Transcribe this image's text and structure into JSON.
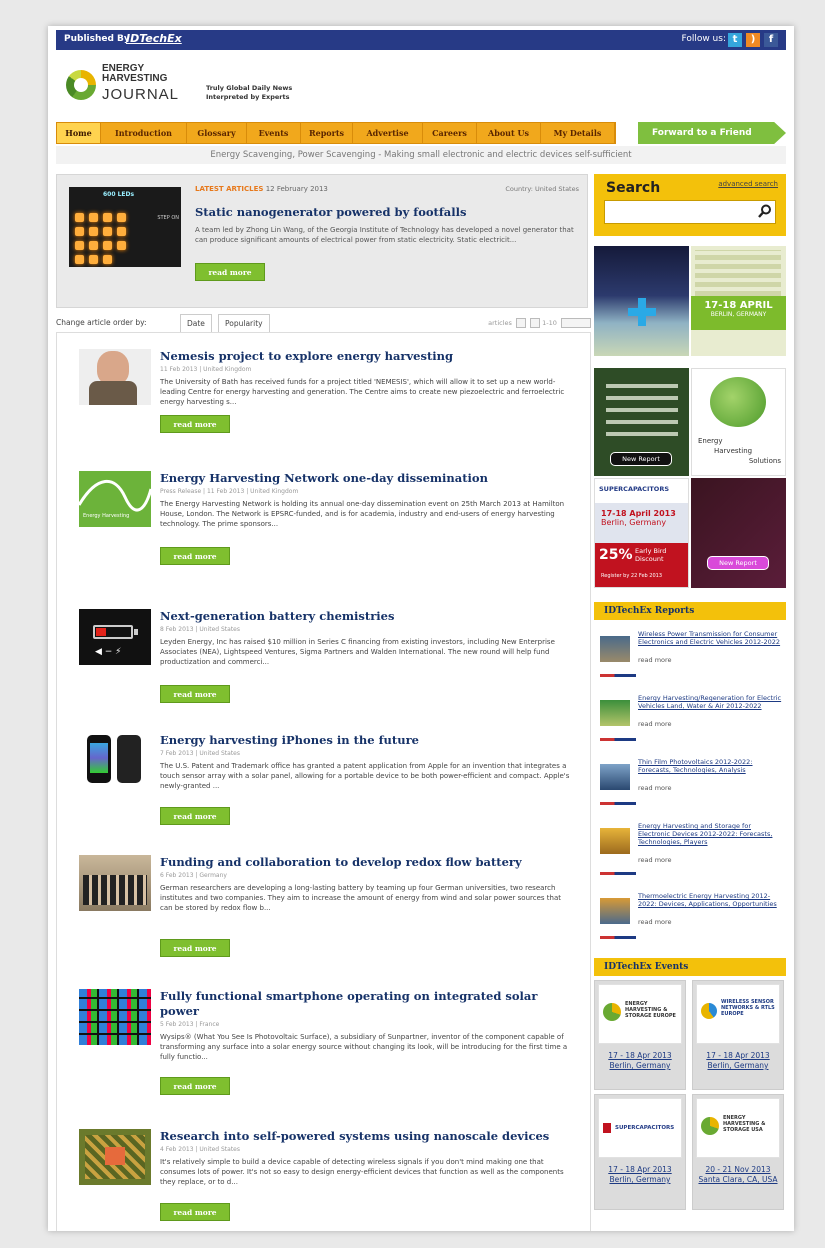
{
  "topbar": {
    "published_by": "Published By",
    "brand": "IDTechEx",
    "follow_us": "Follow us:"
  },
  "logo": {
    "line1": "ENERGY",
    "line2": "HARVESTING",
    "line3": "JOURNAL"
  },
  "tagline": {
    "line1": "Truly Global Daily News",
    "line2": "Interpreted by Experts"
  },
  "nav": {
    "items": [
      "Home",
      "Introduction",
      "Glossary",
      "Events",
      "Reports",
      "Advertise",
      "Careers",
      "About Us",
      "My Details"
    ],
    "forward": "Forward to a Friend"
  },
  "subtitle": "Energy Scavenging, Power Scavenging - Making small electronic and electric devices self-sufficient",
  "featured": {
    "label": "LATEST ARTICLES",
    "date": "12 February 2013",
    "country": "Country: United States",
    "title": "Static nanogenerator powered by footfalls",
    "body": "A team led by Zhong Lin Wang, of the Georgia Institute of Technology has developed a novel generator that can produce significant amounts of electrical power from static electricity. Static electricit...",
    "read_more": "read more",
    "image_label": "600 LEDs",
    "image_label2": "STEP ON"
  },
  "sort": {
    "label": "Change article order by:",
    "tabs": [
      "Date",
      "Popularity"
    ],
    "pagination": "articles",
    "range": "1-10"
  },
  "articles": [
    {
      "title": "Nemesis project to explore energy harvesting",
      "meta": "11 Feb 2013  |  United Kingdom",
      "body": "The University of Bath has received funds for a project titled 'NEMESIS', which will allow it to set up a new world-leading Centre for energy harvesting and generation. The Centre aims to create new piezoelectric and ferroelectric energy harvesting s...",
      "read_more": "read more"
    },
    {
      "title": "Energy Harvesting Network one-day dissemination",
      "meta": "Press Release  |  11 Feb 2013  |  United Kingdom",
      "body": "The Energy Harvesting Network is holding its annual one-day dissemination event on 25th March 2013 at Hamilton House, London. The Network is EPSRC-funded, and is for academia, industry and end-users of energy harvesting technology. The prime sponsors...",
      "read_more": "read more",
      "thumb_text": "Energy Harvesting"
    },
    {
      "title": "Next-generation battery chemistries",
      "meta": "8 Feb 2013  |  United States",
      "body": "Leyden Energy, Inc has raised $10 million in Series C financing from existing investors, including New Enterprise Associates (NEA), Lightspeed Ventures, Sigma Partners and Walden International. The new round will help fund productization and commerci...",
      "read_more": "read more"
    },
    {
      "title": "Energy harvesting iPhones in the future",
      "meta": "7 Feb 2013  |  United States",
      "body": "The U.S. Patent and Trademark office has granted a patent application from Apple for an invention that integrates a touch sensor array with a solar panel, allowing for a portable device to be both power-efficient and compact. Apple's newly-granted ...",
      "read_more": "read more"
    },
    {
      "title": "Funding and collaboration to develop redox flow battery",
      "meta": "6 Feb 2013  |  Germany",
      "body": "German researchers are developing a long-lasting battery by teaming up four German universities, two research institutes and two companies. They aim to increase the amount of energy from wind and solar power sources that can be stored by redox flow b...",
      "read_more": "read more"
    },
    {
      "title": "Fully functional smartphone operating on integrated solar power",
      "meta": "5 Feb 2013  |  France",
      "body": "Wysips® (What You See Is Photovoltaic Surface), a subsidiary of Sunpartner, inventor of the component capable of transforming any surface into a solar energy source without changing its look, will be introducing for the first time a fully functio...",
      "read_more": "read more"
    },
    {
      "title": "Research into self-powered systems using nanoscale devices",
      "meta": "4 Feb 2013  |  United States",
      "body": "It's relatively simple to build a device capable of detecting wireless signals if you don't mind making one that consumes lots of power. It's not so easy to design energy-efficient devices that function as well as the components they replace, or to d...",
      "read_more": "read more"
    }
  ],
  "search": {
    "heading": "Search",
    "advanced": "advanced search"
  },
  "ads": {
    "ad1_date": "17-18 APRIL",
    "ad1_place": "BERLIN, GERMANY",
    "ad2_button": "New Report",
    "ad2_caption1": "Energy",
    "ad2_caption2": "Harvesting",
    "ad2_caption3": "Solutions",
    "ad3_brand": "SUPERCAPACITORS",
    "ad3_date": "17-18 April 2013",
    "ad3_place": "Berlin, Germany",
    "ad3_pct": "25%",
    "ad3_discount1": "Early Bird",
    "ad3_discount2": "Discount",
    "ad3_register": "Register by 22 Feb 2013",
    "ad4_button": "New Report"
  },
  "reports": {
    "heading": "IDTechEx Reports",
    "items": [
      {
        "title": "Wireless Power Transmission for Consumer Electronics and Electric Vehicles 2012-2022",
        "more": "read more"
      },
      {
        "title": "Energy Harvesting/Regeneration for Electric Vehicles Land, Water & Air 2012-2022",
        "more": "read more"
      },
      {
        "title": "Thin Film Photovoltaics 2012-2022: Forecasts, Technologies, Analysis",
        "more": "read more"
      },
      {
        "title": "Energy Harvesting and Storage for Electronic Devices 2012-2022: Forecasts, Technologies, Players",
        "more": "read more"
      },
      {
        "title": "Thermoelectric Energy Harvesting 2012-2022: Devices, Applications, Opportunities",
        "more": "read more"
      }
    ]
  },
  "events": {
    "heading": "IDTechEx Events",
    "items": [
      {
        "date": "17 - 18 Apr 2013",
        "place": "Berlin, Germany",
        "logo": "ENERGY HARVESTING & STORAGE EUROPE"
      },
      {
        "date": "17 - 18 Apr 2013",
        "place": "Berlin, Germany",
        "logo": "WIRELESS SENSOR NETWORKS & RTLS EUROPE"
      },
      {
        "date": "17 - 18 Apr 2013",
        "place": "Berlin, Germany",
        "logo": "SUPERCAPACITORS"
      },
      {
        "date": "20 - 21 Nov 2013",
        "place": "Santa Clara, CA, USA",
        "logo": "ENERGY HARVESTING & STORAGE USA"
      }
    ]
  },
  "colors": {
    "nav_bg": "#f1a81c",
    "topbar_bg": "#273a86",
    "accent_green": "#7fbf2f",
    "title_blue": "#163268",
    "search_yellow": "#f3c10b"
  }
}
